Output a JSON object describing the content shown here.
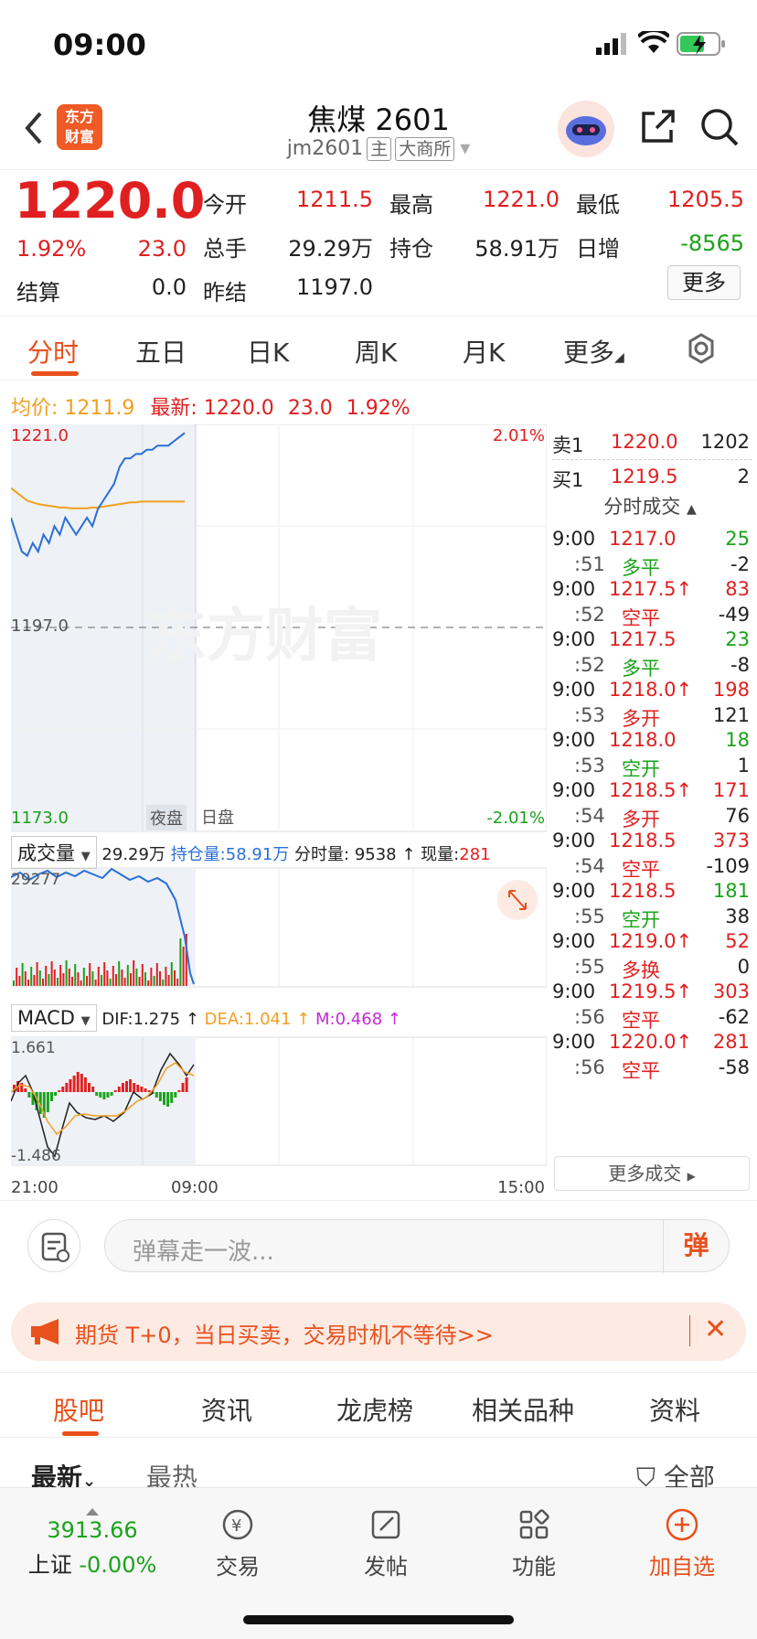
{
  "status": {
    "time": "09:00"
  },
  "nav": {
    "title": "焦煤 2601",
    "code": "jm2601",
    "tag_main": "主",
    "tag_exchange": "大商所",
    "logo": "东方\n财富"
  },
  "quote": {
    "price": "1220.0",
    "pct": "1.92%",
    "change": "23.0",
    "open_label": "今开",
    "open": "1211.5",
    "high_label": "最高",
    "high": "1221.0",
    "low_label": "最低",
    "low": "1205.5",
    "vol_label": "总手",
    "vol": "29.29万",
    "oi_label": "持仓",
    "oi": "58.91万",
    "daily_inc_label": "日增",
    "daily_inc": "-8565",
    "settle_label": "结算",
    "settle": "0.0",
    "prev_settle_label": "昨结",
    "prev_settle": "1197.0",
    "more": "更多"
  },
  "tabs": [
    "分时",
    "五日",
    "日K",
    "周K",
    "月K",
    "更多"
  ],
  "avg": {
    "avg_label": "均价:",
    "avg": "1211.9",
    "latest_label": "最新:",
    "latest": "1220.0",
    "chg": "23.0",
    "pct": "1.92%"
  },
  "chart": {
    "high": "1221.0",
    "low": "1173.0",
    "mid": "1197.0",
    "pct_high": "2.01%",
    "pct_low": "-2.01%",
    "watermark": "东方财富",
    "night": "夜盘",
    "day": "日盘",
    "vol_selector": "成交量",
    "vol_total": "29.29万",
    "oi_label": "持仓量:",
    "oi_val": "58.91万",
    "min_vol": "分时量: 9538 ↑",
    "now_label": "现量:",
    "now_val": "281",
    "vol_axis": "29277",
    "macd_selector": "MACD",
    "dif": "DIF:1.275 ↑",
    "dea": "DEA:1.041 ↑",
    "m": "M:0.468 ↑",
    "macd_high": "1.661",
    "macd_low": "-1.486",
    "t_start": "21:00",
    "t_mid": "09:00",
    "t_end": "15:00"
  },
  "chart_data": {
    "type": "line",
    "price_series": [
      1210,
      1208,
      1206,
      1205.5,
      1207,
      1206,
      1208,
      1207,
      1209,
      1208,
      1210,
      1209,
      1208,
      1209,
      1210,
      1209,
      1211,
      1212,
      1213,
      1214,
      1216,
      1217,
      1217,
      1217.5,
      1217.5,
      1218,
      1218,
      1218.5,
      1218.5,
      1218.5,
      1219,
      1219.5,
      1220
    ],
    "avg_series": [
      1213.5,
      1213,
      1212.5,
      1212,
      1211.8,
      1211.6,
      1211.5,
      1211.4,
      1211.3,
      1211.2,
      1211.2,
      1211.1,
      1211.1,
      1211.1,
      1211.1,
      1211.2,
      1211.2,
      1211.3,
      1211.4,
      1211.5,
      1211.6,
      1211.7,
      1211.8,
      1211.8,
      1211.9,
      1211.9,
      1211.9,
      1211.9,
      1211.9,
      1211.9,
      1211.9,
      1211.9,
      1211.9
    ],
    "ylim": [
      1173.0,
      1221.0
    ]
  },
  "trades": {
    "ask_label": "卖1",
    "ask": "1220.0",
    "ask_vol": "1202",
    "bid_label": "买1",
    "bid": "1219.5",
    "bid_vol": "2",
    "header": "分时成交",
    "rows": [
      {
        "t": "9:00",
        "p": "1217.0",
        "v": "25",
        "s": ":51",
        "type": "多平",
        "d": "-2",
        "pc": "red",
        "vc": "green",
        "tc": "green"
      },
      {
        "t": "9:00",
        "p": "1217.5↑",
        "v": "83",
        "s": ":52",
        "type": "空平",
        "d": "-49",
        "pc": "red",
        "vc": "red",
        "tc": "red"
      },
      {
        "t": "9:00",
        "p": "1217.5",
        "v": "23",
        "s": ":52",
        "type": "多平",
        "d": "-8",
        "pc": "red",
        "vc": "green",
        "tc": "green"
      },
      {
        "t": "9:00",
        "p": "1218.0↑",
        "v": "198",
        "s": ":53",
        "type": "多开",
        "d": "121",
        "pc": "red",
        "vc": "red",
        "tc": "red"
      },
      {
        "t": "9:00",
        "p": "1218.0",
        "v": "18",
        "s": ":53",
        "type": "空开",
        "d": "1",
        "pc": "red",
        "vc": "green",
        "tc": "green"
      },
      {
        "t": "9:00",
        "p": "1218.5↑",
        "v": "171",
        "s": ":54",
        "type": "多开",
        "d": "76",
        "pc": "red",
        "vc": "red",
        "tc": "red"
      },
      {
        "t": "9:00",
        "p": "1218.5",
        "v": "373",
        "s": ":54",
        "type": "空平",
        "d": "-109",
        "pc": "red",
        "vc": "red",
        "tc": "red"
      },
      {
        "t": "9:00",
        "p": "1218.5",
        "v": "181",
        "s": ":55",
        "type": "空开",
        "d": "38",
        "pc": "red",
        "vc": "green",
        "tc": "green"
      },
      {
        "t": "9:00",
        "p": "1219.0↑",
        "v": "52",
        "s": ":55",
        "type": "多换",
        "d": "0",
        "pc": "red",
        "vc": "red",
        "tc": "red"
      },
      {
        "t": "9:00",
        "p": "1219.5↑",
        "v": "303",
        "s": ":56",
        "type": "空平",
        "d": "-62",
        "pc": "red",
        "vc": "red",
        "tc": "red"
      },
      {
        "t": "9:00",
        "p": "1220.0↑",
        "v": "281",
        "s": ":56",
        "type": "空平",
        "d": "-58",
        "pc": "red",
        "vc": "red",
        "tc": "red"
      }
    ],
    "more": "更多成交"
  },
  "comment": {
    "placeholder": "弹幕走一波...",
    "button": "弹"
  },
  "promo": {
    "text": "期货 T+0，当日买卖，交易时机不等待>>"
  },
  "guba_tabs": [
    "股吧",
    "资讯",
    "龙虎榜",
    "相关品种",
    "资料"
  ],
  "sort": {
    "latest": "最新",
    "hot": "最热",
    "filter": "全部"
  },
  "bottom": {
    "index_val": "3913.66",
    "index_name": "上证",
    "index_pct": "-0.00%",
    "trade": "交易",
    "post": "发帖",
    "func": "功能",
    "add": "加自选"
  }
}
